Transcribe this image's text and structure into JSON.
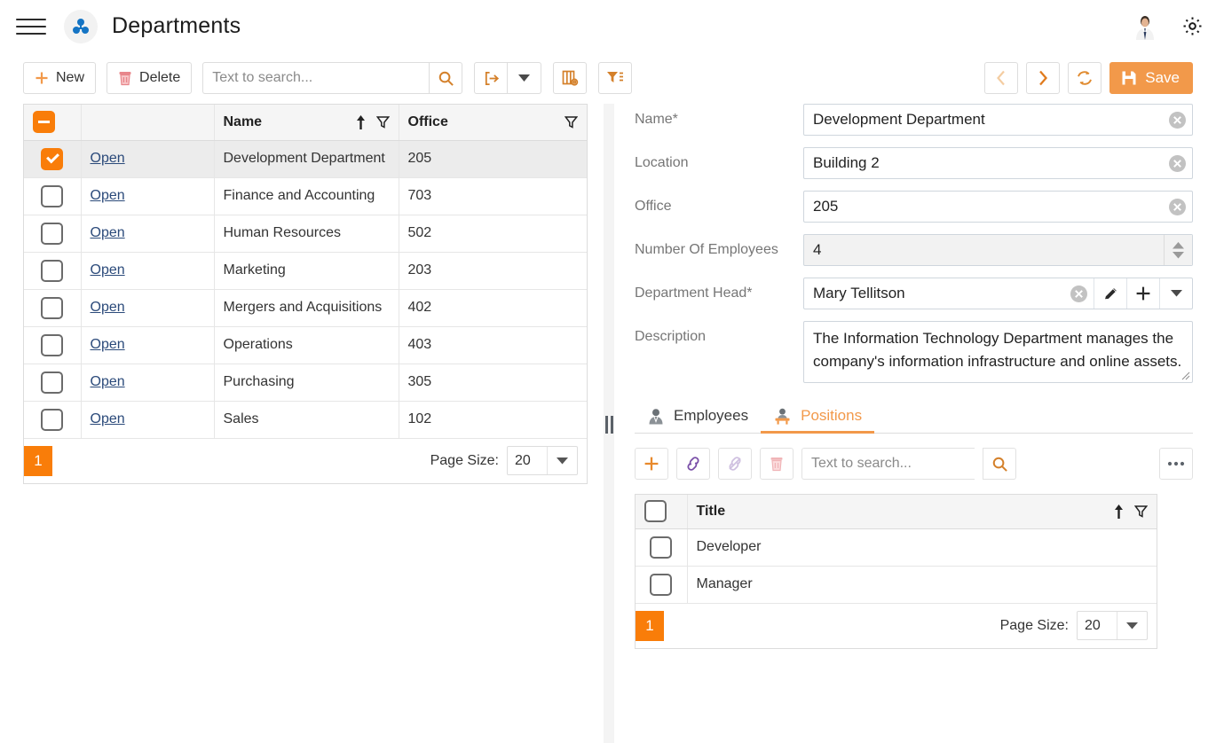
{
  "appbar": {
    "menu_icon": "hamburger-icon",
    "logo_icon": "departments-cubes-icon",
    "title": "Departments",
    "avatar_icon": "user-avatar",
    "settings_icon": "gear-icon"
  },
  "toolbar": {
    "new_label": "New",
    "new_icon": "plus-icon",
    "delete_label": "Delete",
    "delete_icon": "trash-icon",
    "search_placeholder": "Text to search...",
    "search_value": "",
    "search_icon": "search-icon",
    "export_icon": "export-icon",
    "export_dropdown_icon": "chevron-down-icon",
    "columns_icon": "column-chooser-icon",
    "filter_icon": "filter-list-icon",
    "prev_icon": "chevron-left-icon",
    "next_icon": "chevron-right-icon",
    "refresh_icon": "refresh-icon",
    "save_label": "Save",
    "save_icon": "floppy-disk-icon",
    "accent_color": "#f2994a"
  },
  "grid": {
    "select_all_state": "indeterminate",
    "columns": [
      {
        "label": "",
        "name": "select-column"
      },
      {
        "label": "",
        "name": "open-column"
      },
      {
        "label": "Name",
        "name": "name-column",
        "sort": "asc",
        "sort_icon": "sort-ascending-icon",
        "filter_icon": "filter-icon"
      },
      {
        "label": "Office",
        "name": "office-column",
        "filter_icon": "filter-icon"
      }
    ],
    "open_label": "Open",
    "rows": [
      {
        "selected": true,
        "name": "Development Department",
        "office": "205"
      },
      {
        "selected": false,
        "name": "Finance and Accounting",
        "office": "703"
      },
      {
        "selected": false,
        "name": "Human Resources",
        "office": "502"
      },
      {
        "selected": false,
        "name": "Marketing",
        "office": "203"
      },
      {
        "selected": false,
        "name": "Mergers and Acquisitions",
        "office": "402"
      },
      {
        "selected": false,
        "name": "Operations",
        "office": "403"
      },
      {
        "selected": false,
        "name": "Purchasing",
        "office": "305"
      },
      {
        "selected": false,
        "name": "Sales",
        "office": "102"
      }
    ],
    "pager": {
      "current_page": "1",
      "page_size_label": "Page Size:",
      "page_size_value": "20"
    }
  },
  "splitter": {
    "grip_icon": "splitter-grip-icon"
  },
  "form": {
    "fields": [
      {
        "label": "Name*",
        "value": "Development Department",
        "name": "name-field",
        "clear_icon": "clear-circle-icon"
      },
      {
        "label": "Location",
        "value": "Building 2",
        "name": "location-field",
        "clear_icon": "clear-circle-icon"
      },
      {
        "label": "Office",
        "value": "205",
        "name": "office-field",
        "clear_icon": "clear-circle-icon"
      }
    ],
    "employees": {
      "label": "Number Of Employees",
      "value": "4",
      "spinner_up_icon": "spinner-up-icon",
      "spinner_down_icon": "spinner-down-icon"
    },
    "department_head": {
      "label": "Department Head*",
      "value": "Mary Tellitson",
      "clear_icon": "clear-circle-icon",
      "edit_icon": "pencil-icon",
      "add_icon": "plus-icon",
      "dropdown_icon": "chevron-down-icon"
    },
    "description": {
      "label": "Description",
      "value": "The Information Technology Department manages the company's information infrastructure and online assets.",
      "resize_icon": "resize-grip-icon"
    }
  },
  "tabs": [
    {
      "label": "Employees",
      "icon": "employee-person-icon",
      "active": false,
      "name": "tab-employees"
    },
    {
      "label": "Positions",
      "icon": "position-desk-icon",
      "active": true,
      "name": "tab-positions"
    }
  ],
  "sub_toolbar": {
    "add_icon": "plus-icon",
    "link_icon": "link-icon",
    "unlink_icon": "unlink-icon",
    "delete_icon": "trash-icon",
    "search_placeholder": "Text to search...",
    "search_value": "",
    "search_icon": "search-icon",
    "more_icon": "ellipsis-icon"
  },
  "positions_grid": {
    "columns": [
      {
        "label": "",
        "name": "select-column"
      },
      {
        "label": "Title",
        "name": "title-column",
        "sort_icon": "sort-ascending-icon",
        "filter_icon": "filter-icon"
      }
    ],
    "rows": [
      {
        "selected": false,
        "title": "Developer"
      },
      {
        "selected": false,
        "title": "Manager"
      }
    ],
    "pager": {
      "current_page": "1",
      "page_size_label": "Page Size:",
      "page_size_value": "20"
    }
  }
}
